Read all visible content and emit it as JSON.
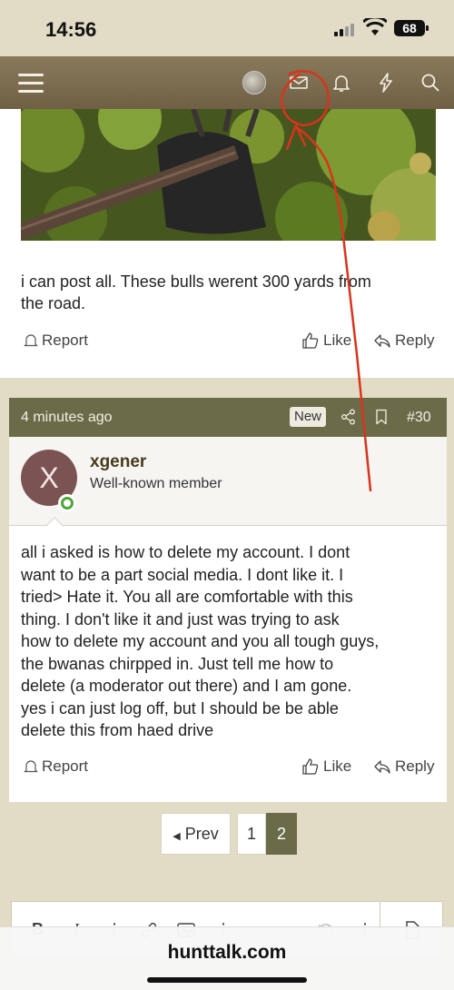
{
  "status_bar": {
    "time": "14:56",
    "battery": "68"
  },
  "post1": {
    "text_line1": "i can post all. These bulls werent 300 yards from",
    "text_line2": "the road.",
    "report": "Report",
    "like": "Like",
    "reply": "Reply"
  },
  "post2": {
    "time": "4 minutes ago",
    "badge": "New",
    "number": "#30",
    "avatar_letter": "X",
    "username": "xgener",
    "user_title": "Well-known member",
    "lines": [
      "all i asked is how to delete my account. I dont",
      "want to be a part social media. I dont like it. I",
      "tried> Hate it. You all are comfortable with this",
      "thing. I don't like it and just was trying to ask",
      "how to delete my account and you all tough guys,",
      "the bwanas chirpped in. Just tell me how to",
      "delete (a moderator out there) and I am gone.",
      "yes i can just log off, but I should be be able",
      "delete this from haed drive"
    ],
    "report": "Report",
    "like": "Like",
    "reply": "Reply"
  },
  "pagination": {
    "prev": "Prev",
    "page1": "1",
    "page2": "2"
  },
  "browser": {
    "url": "hunttalk.com"
  },
  "colors": {
    "nav": "#7d6e52",
    "post_header": "#6b6b4a",
    "annotation": "#d8341c"
  }
}
